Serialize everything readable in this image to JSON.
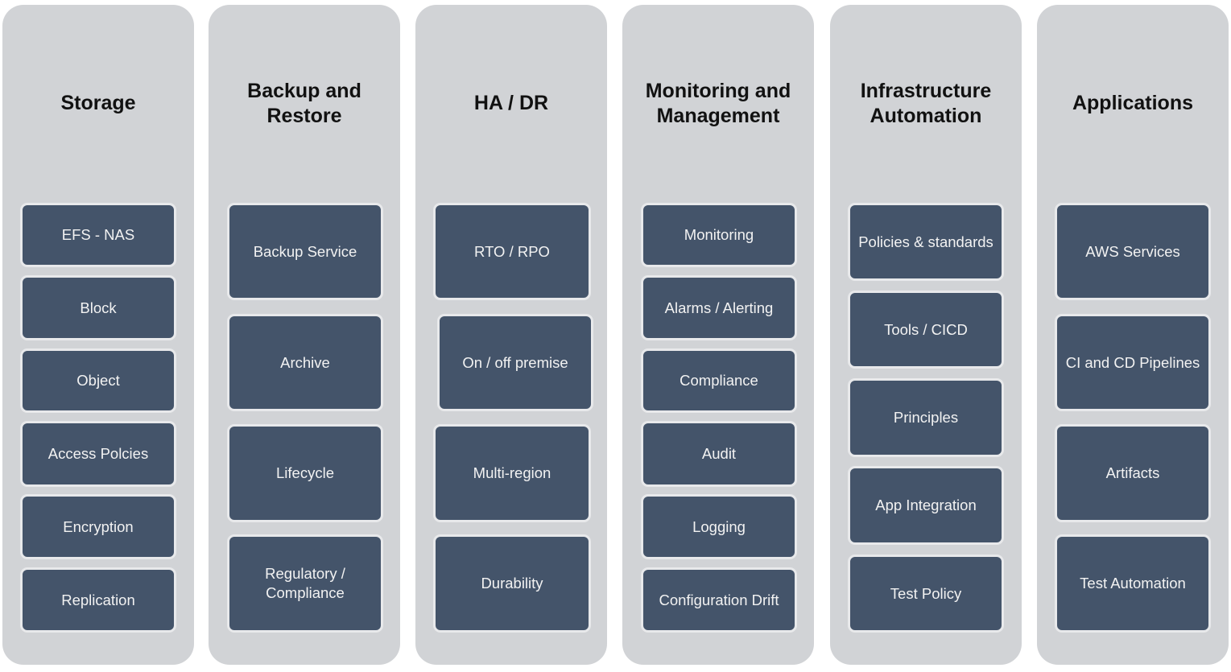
{
  "diagram": {
    "colors": {
      "column_background": "#d1d3d6",
      "box_fill": "#44546a",
      "box_border": "#e8e9eb",
      "box_text": "#f2f2f2",
      "title_text": "#111111"
    },
    "columns": [
      {
        "title": "Storage",
        "items": [
          "EFS - NAS",
          "Block",
          "Object",
          "Access Polcies",
          "Encryption",
          "Replication"
        ]
      },
      {
        "title": "Backup and\nRestore",
        "items": [
          "Backup Service",
          "Archive",
          "Lifecycle",
          "Regulatory /\nCompliance"
        ]
      },
      {
        "title": "HA / DR",
        "items": [
          "RTO / RPO",
          "On / off premise",
          "Multi-region",
          "Durability"
        ]
      },
      {
        "title": "Monitoring and\nManagement",
        "items": [
          "Monitoring",
          "Alarms / Alerting",
          "Compliance",
          "Audit",
          "Logging",
          "Configuration Drift"
        ]
      },
      {
        "title": "Infrastructure\nAutomation",
        "items": [
          "Policies & standards",
          "Tools / CICD",
          "Principles",
          "App Integration",
          "Test Policy"
        ]
      },
      {
        "title": "Applications",
        "items": [
          "AWS Services",
          "CI and CD Pipelines",
          "Artifacts",
          "Test Automation"
        ]
      }
    ]
  }
}
